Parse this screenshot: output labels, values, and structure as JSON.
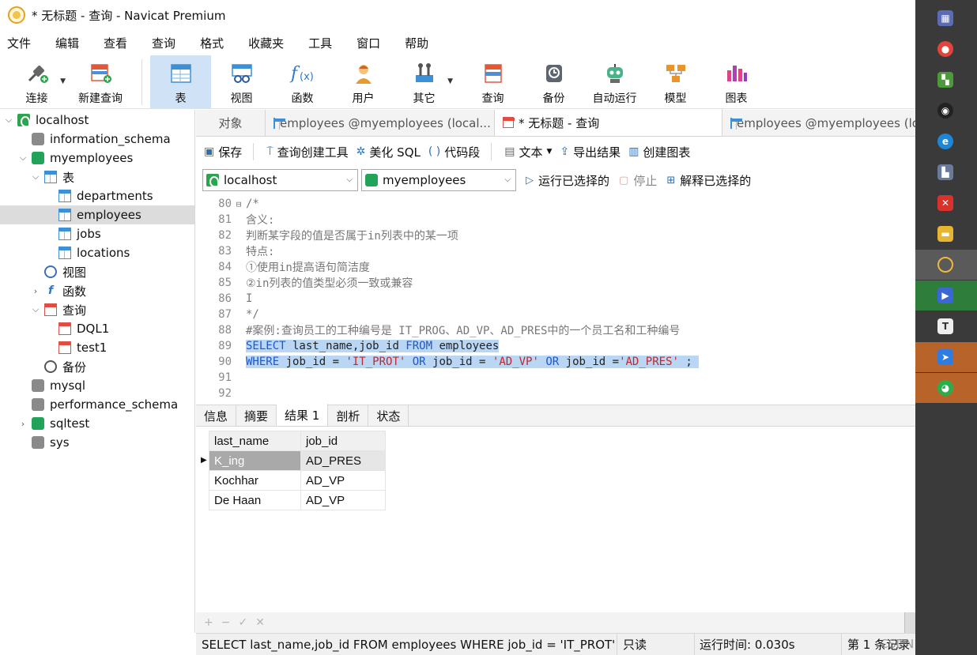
{
  "window": {
    "title": "* 无标题 - 查询 - Navicat Premium"
  },
  "menu": [
    "文件",
    "编辑",
    "查看",
    "查询",
    "格式",
    "收藏夹",
    "工具",
    "窗口",
    "帮助"
  ],
  "toolbar": {
    "connect": "连接",
    "new_query": "新建查询",
    "table": "表",
    "view": "视图",
    "function": "函数",
    "user": "用户",
    "other": "其它",
    "query": "查询",
    "backup": "备份",
    "automation": "自动运行",
    "model": "模型",
    "chart": "图表"
  },
  "tree": {
    "localhost": "localhost",
    "information_schema": "information_schema",
    "myemployees": "myemployees",
    "tables_group": "表",
    "departments": "departments",
    "employees": "employees",
    "jobs": "jobs",
    "locations": "locations",
    "views_group": "视图",
    "functions_group": "函数",
    "queries_group": "查询",
    "query1": "DQL1",
    "query2": "test1",
    "backup_group": "备份",
    "mysql": "mysql",
    "performance_schema": "performance_schema",
    "sqltest": "sqltest",
    "sys": "sys"
  },
  "tabs": {
    "objects": "对象",
    "tab1": "employees @myemployees (local...",
    "tab2": "* 无标题 - 查询",
    "tab3": "employees @myemployees (lo"
  },
  "editor_toolbar": {
    "save": "保存",
    "query_builder": "查询创建工具",
    "beautify": "美化 SQL",
    "snippet": "代码段",
    "text": "文本",
    "export": "导出结果",
    "create_chart": "创建图表"
  },
  "connection_bar": {
    "connection": "localhost",
    "database": "myemployees",
    "run_selected": "运行已选择的",
    "stop": "停止",
    "explain": "解释已选择的"
  },
  "code_lines": [
    {
      "n": "80",
      "text": "/*"
    },
    {
      "n": "81",
      "text": "含义:"
    },
    {
      "n": "82",
      "text": "判断某字段的值是否属于in列表中的某一项"
    },
    {
      "n": "83",
      "text": "特点:"
    },
    {
      "n": "84",
      "text": "①使用in提高语句简洁度"
    },
    {
      "n": "85",
      "text": "②in列表的值类型必须一致或兼容"
    },
    {
      "n": "86",
      "text": "I"
    },
    {
      "n": "87",
      "text": "*/"
    },
    {
      "n": "88",
      "text": "#案例:查询员工的工种编号是 IT_PROG、AD_VP、AD_PRES中的一个员工名和工种编号"
    },
    {
      "n": "89"
    },
    {
      "n": "90"
    },
    {
      "n": "91"
    },
    {
      "n": "92"
    }
  ],
  "sql": {
    "select": "SELECT",
    "cols": " last_name,job_id ",
    "from": "FROM",
    "table": " employees",
    "where": "WHERE",
    "col1": " job_id = ",
    "v1": "'IT_PROT'",
    "or1": " OR",
    "col2": " job_id = ",
    "v2": "'AD_VP'",
    "or2": " OR",
    "col3": " job_id =",
    "v3": "'AD_PRES'",
    "end": " ;"
  },
  "result_tabs": [
    "信息",
    "摘要",
    "结果 1",
    "剖析",
    "状态"
  ],
  "result": {
    "columns": [
      "last_name",
      "job_id"
    ],
    "rows": [
      [
        "K_ing",
        "AD_PRES"
      ],
      [
        "Kochhar",
        "AD_VP"
      ],
      [
        "De Haan",
        "AD_VP"
      ]
    ]
  },
  "grid_footer": [
    "+",
    "−",
    "✓",
    "✕"
  ],
  "status": {
    "sql": "SELECT last_name,job_id FROM employees WHERE job_id = 'IT_PROT' OR",
    "readonly": "只读",
    "time": "运行时间: 0.030s",
    "records": "第 1 条记录",
    "watermark": "CSDN @王小小鸭"
  }
}
